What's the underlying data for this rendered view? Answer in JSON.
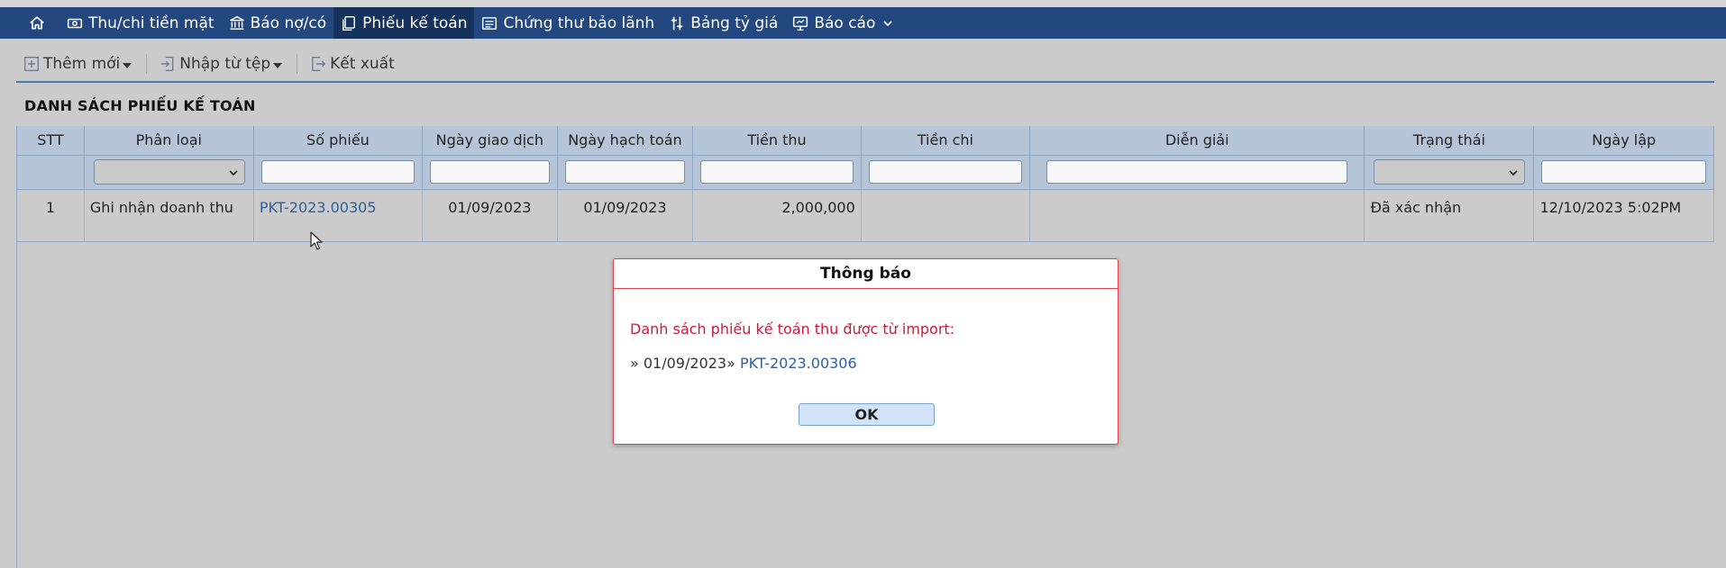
{
  "nav": {
    "items": [
      {
        "label": "Thu/chi tiền mặt",
        "icon": "cash-icon"
      },
      {
        "label": "Báo nợ/có",
        "icon": "bank-icon"
      },
      {
        "label": "Phiếu kế toán",
        "icon": "documents-icon",
        "active": true
      },
      {
        "label": "Chứng thư bảo lãnh",
        "icon": "certificate-icon"
      },
      {
        "label": "Bảng tỷ giá",
        "icon": "exchange-icon"
      },
      {
        "label": "Báo cáo",
        "icon": "report-icon"
      }
    ]
  },
  "toolbar": {
    "add_label": "Thêm mới",
    "import_label": "Nhập từ tệp",
    "export_label": "Kết xuất"
  },
  "list": {
    "title": "DANH SÁCH PHIẾU KẾ TOÁN",
    "columns": [
      "STT",
      "Phân loại",
      "Số phiếu",
      "Ngày giao dịch",
      "Ngày hạch toán",
      "Tiền thu",
      "Tiền chi",
      "Diễn giải",
      "Trạng thái",
      "Ngày lập"
    ],
    "rows": [
      {
        "stt": "1",
        "category": "Ghi nhận doanh thu",
        "voucher_no": "PKT-2023.00305",
        "transaction_date": "01/09/2023",
        "posting_date": "01/09/2023",
        "receipt_amount": "2,000,000",
        "payment_amount": "",
        "description": "",
        "status": "Đã xác nhận",
        "created_at": "12/10/2023 5:02PM"
      }
    ]
  },
  "dialog": {
    "title": "Thông báo",
    "message": "Danh sách phiếu kế toán thu được từ import:",
    "item_prefix": "» 01/09/2023»",
    "item_link": "PKT-2023.00306",
    "ok_label": "OK"
  },
  "colors": {
    "navbar": "#23487f",
    "navbar_active": "#15325c",
    "header_bg": "#b5c4d6",
    "link": "#2f5f9e",
    "alert_red": "#d01838"
  }
}
